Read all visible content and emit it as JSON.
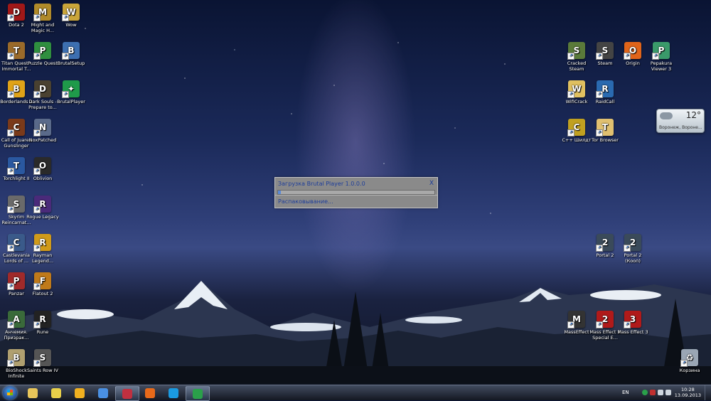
{
  "desktop_icons_left": [
    {
      "label": "Dota 2",
      "icon": "dota2-icon",
      "color": "#a01818",
      "glyph": "D"
    },
    {
      "label": "Might and Magic H...",
      "icon": "might-and-magic-icon",
      "color": "#b08a2a",
      "glyph": "M"
    },
    {
      "label": "Wow",
      "icon": "wow-icon",
      "color": "#c9a53a",
      "glyph": "W"
    },
    {
      "label": "Titan Quest - Immortal T...",
      "icon": "titan-quest-icon",
      "color": "#9a6a2a",
      "glyph": "T"
    },
    {
      "label": "Puzzle Quest",
      "icon": "puzzle-quest-icon",
      "color": "#2f8f3f",
      "glyph": "P"
    },
    {
      "label": "BrutalSetup",
      "icon": "brutal-setup-icon",
      "color": "#3d6fb0",
      "glyph": "B"
    },
    {
      "label": "Borderlands 2",
      "icon": "borderlands2-icon",
      "color": "#e0a318",
      "glyph": "B"
    },
    {
      "label": "Dark Souls - Prepare to...",
      "icon": "dark-souls-icon",
      "color": "#4a4130",
      "glyph": "D"
    },
    {
      "label": "BrutalPlayer",
      "icon": "brutal-player-icon",
      "color": "#1f9a4a",
      "glyph": "✦"
    },
    {
      "label": "Call of Juarez Gunslinger",
      "icon": "call-of-juarez-icon",
      "color": "#7a3a1a",
      "glyph": "C"
    },
    {
      "label": "NoxPatched",
      "icon": "noxpatched-icon",
      "color": "#5a6a8a",
      "glyph": "N"
    },
    {
      "label": "Torchlight II",
      "icon": "torchlight2-icon",
      "color": "#2a58a0",
      "glyph": "T"
    },
    {
      "label": "Oblivion",
      "icon": "oblivion-icon",
      "color": "#2a2a2a",
      "glyph": "O"
    },
    {
      "label": "Skyrim Reincarnat...",
      "icon": "skyrim-icon",
      "color": "#6a6a6a",
      "glyph": "S"
    },
    {
      "label": "Rogue Legacy",
      "icon": "rogue-legacy-icon",
      "color": "#4a2a7a",
      "glyph": "R"
    },
    {
      "label": "Castlevania Lords of ...",
      "icon": "castlevania-icon",
      "color": "#3a5a8a",
      "glyph": "C"
    },
    {
      "label": "Rayman Legend...",
      "icon": "rayman-icon",
      "color": "#d09a1a",
      "glyph": "R"
    },
    {
      "label": "Panzar",
      "icon": "panzar-icon",
      "color": "#a02a2a",
      "glyph": "P"
    },
    {
      "label": "Flatout 2",
      "icon": "flatout2-icon",
      "color": "#c07a1a",
      "glyph": "F"
    },
    {
      "label": "Анчемия. Призрак...",
      "icon": "alchemy-icon",
      "color": "#3a6a3a",
      "glyph": "A"
    },
    {
      "label": "Rune",
      "icon": "rune-icon",
      "color": "#222222",
      "glyph": "R"
    },
    {
      "label": "BioShock Infinite",
      "icon": "bioshock-icon",
      "color": "#b0a070",
      "glyph": "B"
    },
    {
      "label": "Saints Row IV",
      "icon": "saints-row-icon",
      "color": "#555555",
      "glyph": "S"
    }
  ],
  "desktop_icons_right": [
    {
      "label": "Cracked Steam",
      "icon": "cracked-steam-icon",
      "color": "#5a7a3a",
      "glyph": "S"
    },
    {
      "label": "Steam",
      "icon": "steam-icon",
      "color": "#444444",
      "glyph": "S"
    },
    {
      "label": "Origin",
      "icon": "origin-icon",
      "color": "#e0641a",
      "glyph": "O"
    },
    {
      "label": "Pepakura Viewer 3",
      "icon": "pepakura-icon",
      "color": "#3a9a6a",
      "glyph": "P"
    },
    {
      "label": "WifiCrack",
      "icon": "wificrack-icon",
      "color": "#e0c060",
      "glyph": "W"
    },
    {
      "label": "RaidCall",
      "icon": "raidcall-icon",
      "color": "#2a6ab0",
      "glyph": "R"
    },
    {
      "label": "C++ Шилдт",
      "icon": "cpp-book-icon",
      "color": "#c0a020",
      "glyph": "C"
    },
    {
      "label": "Tor Browser",
      "icon": "tor-browser-icon",
      "color": "#e0c070",
      "glyph": "T"
    },
    {
      "label": "Portal 2",
      "icon": "portal2-icon",
      "color": "#3a4a5a",
      "glyph": "2"
    },
    {
      "label": "Portal 2 (Кооп)",
      "icon": "portal2-coop-icon",
      "color": "#3a4a5a",
      "glyph": "2"
    },
    {
      "label": "MassEffect",
      "icon": "mass-effect-icon",
      "color": "#333333",
      "glyph": "M"
    },
    {
      "label": "Mass Effect 2 Special E...",
      "icon": "mass-effect2-icon",
      "color": "#b01a1a",
      "glyph": "2"
    },
    {
      "label": "Mass Effect 3",
      "icon": "mass-effect3-icon",
      "color": "#b01a1a",
      "glyph": "3"
    },
    {
      "label": "Корзина",
      "icon": "recycle-bin-icon",
      "color": "#9aa6b4",
      "glyph": "♻"
    }
  ],
  "weather": {
    "temp": "12°",
    "city": "Воронеж, Вороне..."
  },
  "dialog": {
    "title": "Загрузка Brutal Player 1.0.0.0",
    "close": "X",
    "status": "Распаковывание...",
    "progress": 0.02
  },
  "taskbar": {
    "apps": [
      {
        "name": "explorer",
        "icon": "folder-icon",
        "color": "#e8c65a"
      },
      {
        "name": "network",
        "icon": "network-icon",
        "color": "#e8d04a"
      },
      {
        "name": "ea",
        "icon": "warning-app-icon",
        "color": "#f0b020"
      },
      {
        "name": "chrome",
        "icon": "chrome-icon",
        "color": "#4a90e2"
      },
      {
        "name": "save",
        "icon": "floppy-icon",
        "color": "#c03040"
      },
      {
        "name": "firefox",
        "icon": "firefox-icon",
        "color": "#e86a1a"
      },
      {
        "name": "skype",
        "icon": "skype-icon",
        "color": "#1a9ae0"
      },
      {
        "name": "brutalplayer",
        "icon": "brutal-player-task-icon",
        "color": "#2aa04a"
      }
    ],
    "lang": "EN",
    "time": "10:28",
    "date": "13.09.2013"
  }
}
